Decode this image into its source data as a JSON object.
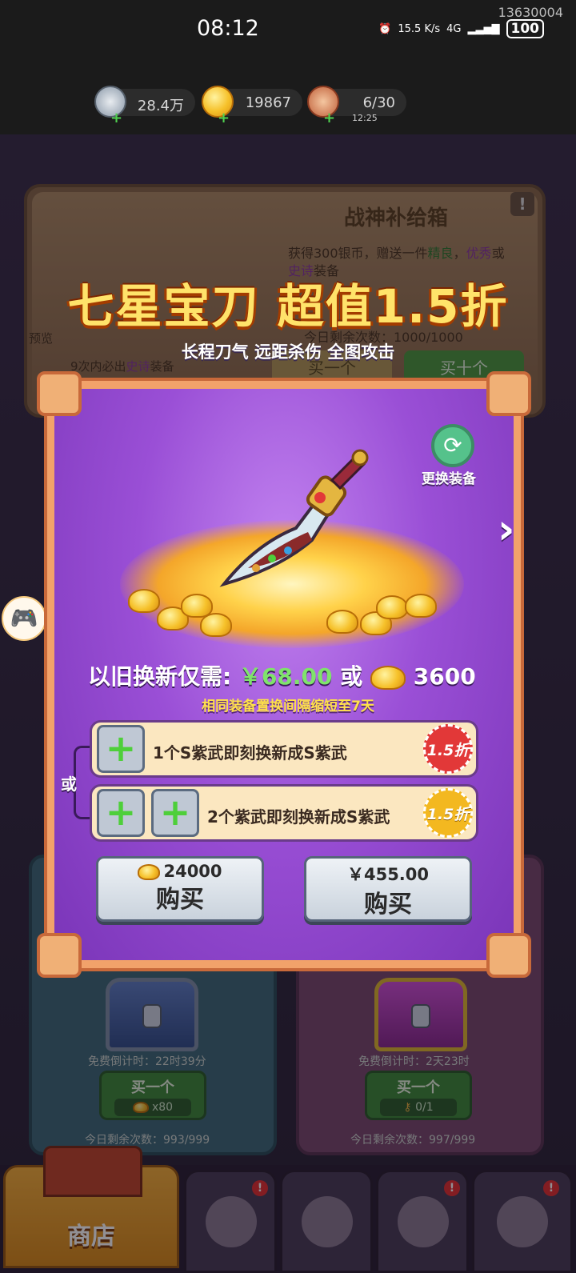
{
  "status_bar": {
    "time": "08:12",
    "device_id": "13630004",
    "net_speed": "15.5 K/s",
    "signal": "4G",
    "battery": "100"
  },
  "resources": {
    "silver": "28.4万",
    "gold": "19867",
    "stamina": "6/30",
    "stamina_timer": "12:25"
  },
  "shop_card": {
    "title": "战神补给箱",
    "desc_prefix": "获得300银币，赠送一件",
    "desc_good": "精良",
    "desc_sep": "，",
    "desc_excellent": "优秀",
    "desc_or": "或",
    "desc_epic": "史诗",
    "desc_suffix": "装备",
    "remaining": "今日剩余次数：1000/1000",
    "preview": "预览",
    "guarantee_prefix": "9次内必出",
    "guarantee_epic": "史诗",
    "guarantee_suffix": "装备",
    "buy_one": "买一个",
    "buy_ten": "买十个",
    "info_icon": "!"
  },
  "banner": {
    "title": "七星宝刀 超值1.5折",
    "subtitle": "长程刀气 远距杀伤 全图攻击"
  },
  "popup": {
    "swap_label": "更换装备",
    "price_prefix": "以旧换新仅需:",
    "price_rmb": "￥68.00",
    "price_or": "或",
    "price_gold": "3600",
    "notice": "相同装备置换间隔缩短至7天",
    "or_label": "或",
    "option1": "1个S紫武即刻换新成S紫武",
    "option1_discount": "1.5折",
    "option2": "2个紫武即刻换新成S紫武",
    "option2_discount": "1.5折",
    "buy_gold_amount": "24000",
    "buy_gold_label": "购买",
    "buy_rmb_amount": "￥455.00",
    "buy_rmb_label": "购买",
    "plus": "+"
  },
  "lower_cards": {
    "left_timer": "免费倒计时：22时39分",
    "left_buy": "买一个",
    "left_cost": "x80",
    "left_remain": "今日剩余次数：993/999",
    "right_timer": "免费倒计时：2天23时",
    "right_buy": "买一个",
    "right_cost": "0/1",
    "right_remain": "今日剩余次数：997/999"
  },
  "bottom_nav": {
    "shop": "商店"
  },
  "colors": {
    "popup_purple": "#9a4fd6",
    "frame_orange": "#f2a26a",
    "price_green": "#7fe36b",
    "notice_yellow": "#ffe14a",
    "discount_red": "#e23838",
    "discount_yellow": "#f3b820"
  },
  "icons": [
    "silver-coin-icon",
    "gold-ingot-icon",
    "meat-icon",
    "swap-icon",
    "next-arrow-icon",
    "plus-icon",
    "gamepad-icon",
    "chest-icon",
    "helmet-icon",
    "sword-icon"
  ]
}
